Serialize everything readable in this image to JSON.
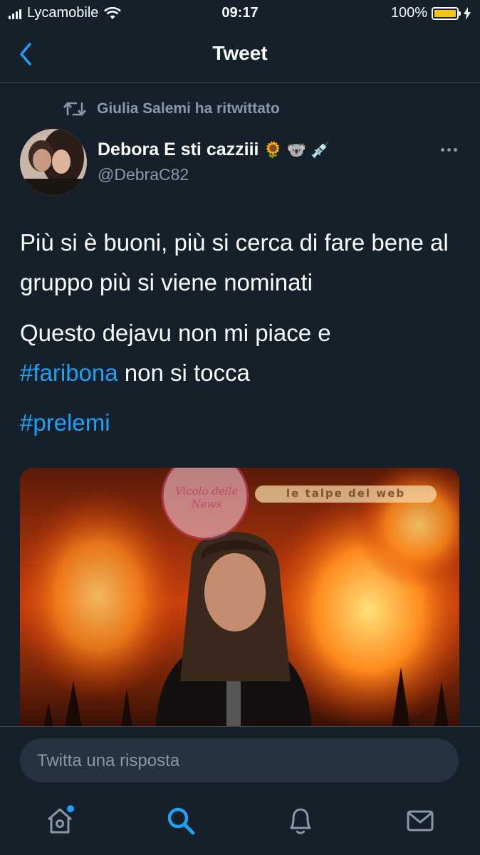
{
  "status_bar": {
    "carrier": "Lycamobile",
    "time": "09:17",
    "battery_percent": "100%",
    "battery_level": 1.0
  },
  "nav": {
    "title": "Tweet"
  },
  "retweet": {
    "label": "Giulia Salemi ha ritwittato"
  },
  "author": {
    "name": "Debora E sti cazziii",
    "name_emojis": [
      "🌻",
      "🐨",
      "💉"
    ],
    "handle": "@DebraC82"
  },
  "tweet": {
    "paragraph1": "Più si è buoni, più si cerca di fare bene al gruppo più si viene nominati",
    "paragraph2_text": "Questo dejavu non mi piace e",
    "hashtag1": "#faribona",
    "paragraph2_suffix": " non si tocca",
    "hashtag2": "#prelemi"
  },
  "media": {
    "description_icons": [
      "fire-image",
      "woman-photo"
    ],
    "watermark_text_1": "Vicolo delle News",
    "watermark_text_2": "le talpe del web"
  },
  "reply": {
    "placeholder": "Twitta una risposta"
  },
  "tabs": [
    "home",
    "search",
    "notifications",
    "messages"
  ],
  "colors": {
    "background": "#15202b",
    "accent": "#1da1f2",
    "secondary_text": "#8899a6",
    "divider": "#38444d",
    "battery": "#f5c518"
  }
}
